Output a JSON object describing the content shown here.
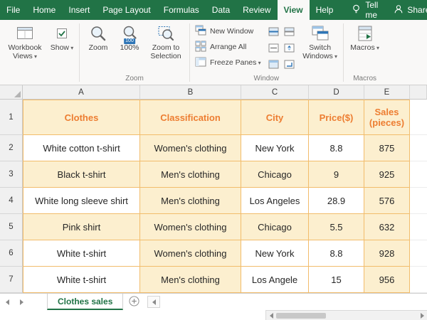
{
  "ribbon": {
    "tabs": [
      {
        "label": "File"
      },
      {
        "label": "Home"
      },
      {
        "label": "Insert"
      },
      {
        "label": "Page Layout"
      },
      {
        "label": "Formulas"
      },
      {
        "label": "Data"
      },
      {
        "label": "Review"
      },
      {
        "label": "View"
      },
      {
        "label": "Help"
      }
    ],
    "active_tab": "View",
    "tell_me": "Tell me",
    "share": "Share",
    "buttons": {
      "workbook_views": "Workbook Views",
      "show": "Show",
      "zoom": "Zoom",
      "zoom_100": "100%",
      "zoom_to_selection": "Zoom to Selection",
      "new_window": "New Window",
      "arrange_all": "Arrange All",
      "freeze_panes": "Freeze Panes",
      "switch_windows": "Switch Windows",
      "macros": "Macros"
    },
    "group_labels": {
      "zoom": "Zoom",
      "window": "Window",
      "macros": "Macros"
    },
    "icons": {
      "zoom_100_badge": "100"
    }
  },
  "grid": {
    "column_headers": [
      "A",
      "B",
      "C",
      "D",
      "E"
    ],
    "row_headers": [
      "1",
      "2",
      "3",
      "4",
      "5",
      "6",
      "7"
    ],
    "table": {
      "headers": [
        "Clothes",
        "Classification",
        "City",
        "Price($)",
        "Sales (pieces)"
      ],
      "rows": [
        [
          "White cotton t-shirt",
          "Women's clothing",
          "New York",
          "8.8",
          "875"
        ],
        [
          "Black t-shirt",
          "Men's clothing",
          "Chicago",
          "9",
          "925"
        ],
        [
          "White long sleeve shirt",
          "Men's clothing",
          "Los Angeles",
          "28.9",
          "576"
        ],
        [
          "Pink shirt",
          "Women's clothing",
          "Chicago",
          "5.5",
          "632"
        ],
        [
          "White t-shirt",
          "Women's clothing",
          "New York",
          "8.8",
          "928"
        ],
        [
          "White t-shirt",
          "Men's clothing",
          "Los Angele",
          "15",
          "956"
        ]
      ]
    }
  },
  "sheet_bar": {
    "active_sheet": "Clothes sales"
  },
  "colors": {
    "green": "#217346",
    "orange_text": "#ED7D31",
    "cream": "#FCEFCF",
    "ob": "#F2BC6B"
  }
}
